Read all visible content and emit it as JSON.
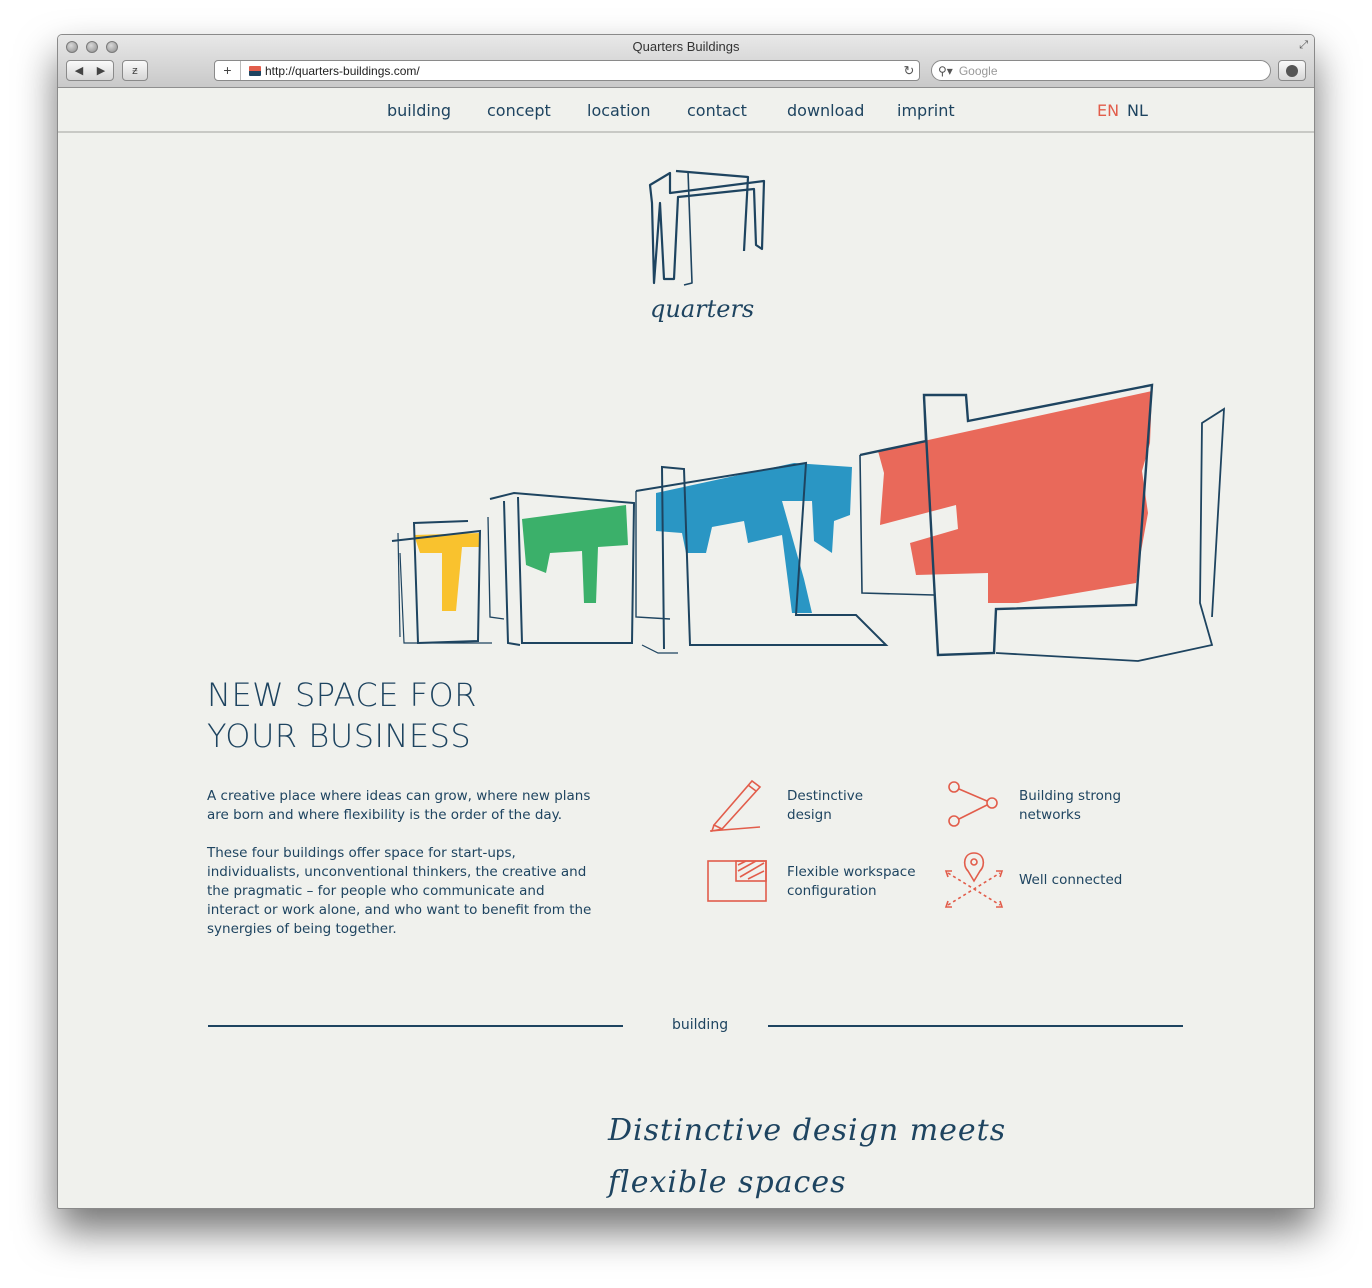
{
  "browser": {
    "window_title": "Quarters Buildings",
    "url": "http://quarters-buildings.com/",
    "search_placeholder": "Google"
  },
  "nav": {
    "items": [
      "building",
      "concept",
      "location",
      "contact",
      "download",
      "imprint"
    ],
    "languages": [
      "EN",
      "NL"
    ],
    "active_language": "EN"
  },
  "logo": {
    "wordmark": "quarters"
  },
  "hero": {
    "building_colors": [
      "#f9c22e",
      "#3bb06a",
      "#2a96c4",
      "#e9695a"
    ]
  },
  "content": {
    "headline_line1": "NEW SPACE FOR",
    "headline_line2": "YOUR BUSINESS",
    "intro_p1": "A creative place where ideas can grow, where new plans are born and where flexibility is the order of the day.",
    "intro_p2": "These four buildings offer space for start-ups, individualists, unconventional thinkers, the creative and the pragmatic – for people who communicate and interact or work alone, and who want to benefit from the synergies of being together."
  },
  "features": [
    {
      "icon": "pencil-icon",
      "label": "Destinctive\ndesign"
    },
    {
      "icon": "network-icon",
      "label": "Building strong\nnetworks"
    },
    {
      "icon": "workspace-icon",
      "label": "Flexible workspace\nconfiguration"
    },
    {
      "icon": "location-pin-icon",
      "label": "Well connected"
    }
  ],
  "section": {
    "label": "building",
    "script_line1": "Distinctive design meets",
    "script_line2": "flexible spaces"
  },
  "colors": {
    "navy": "#1e4460",
    "accent_red": "#e25d4b",
    "background": "#f0f1ed"
  }
}
